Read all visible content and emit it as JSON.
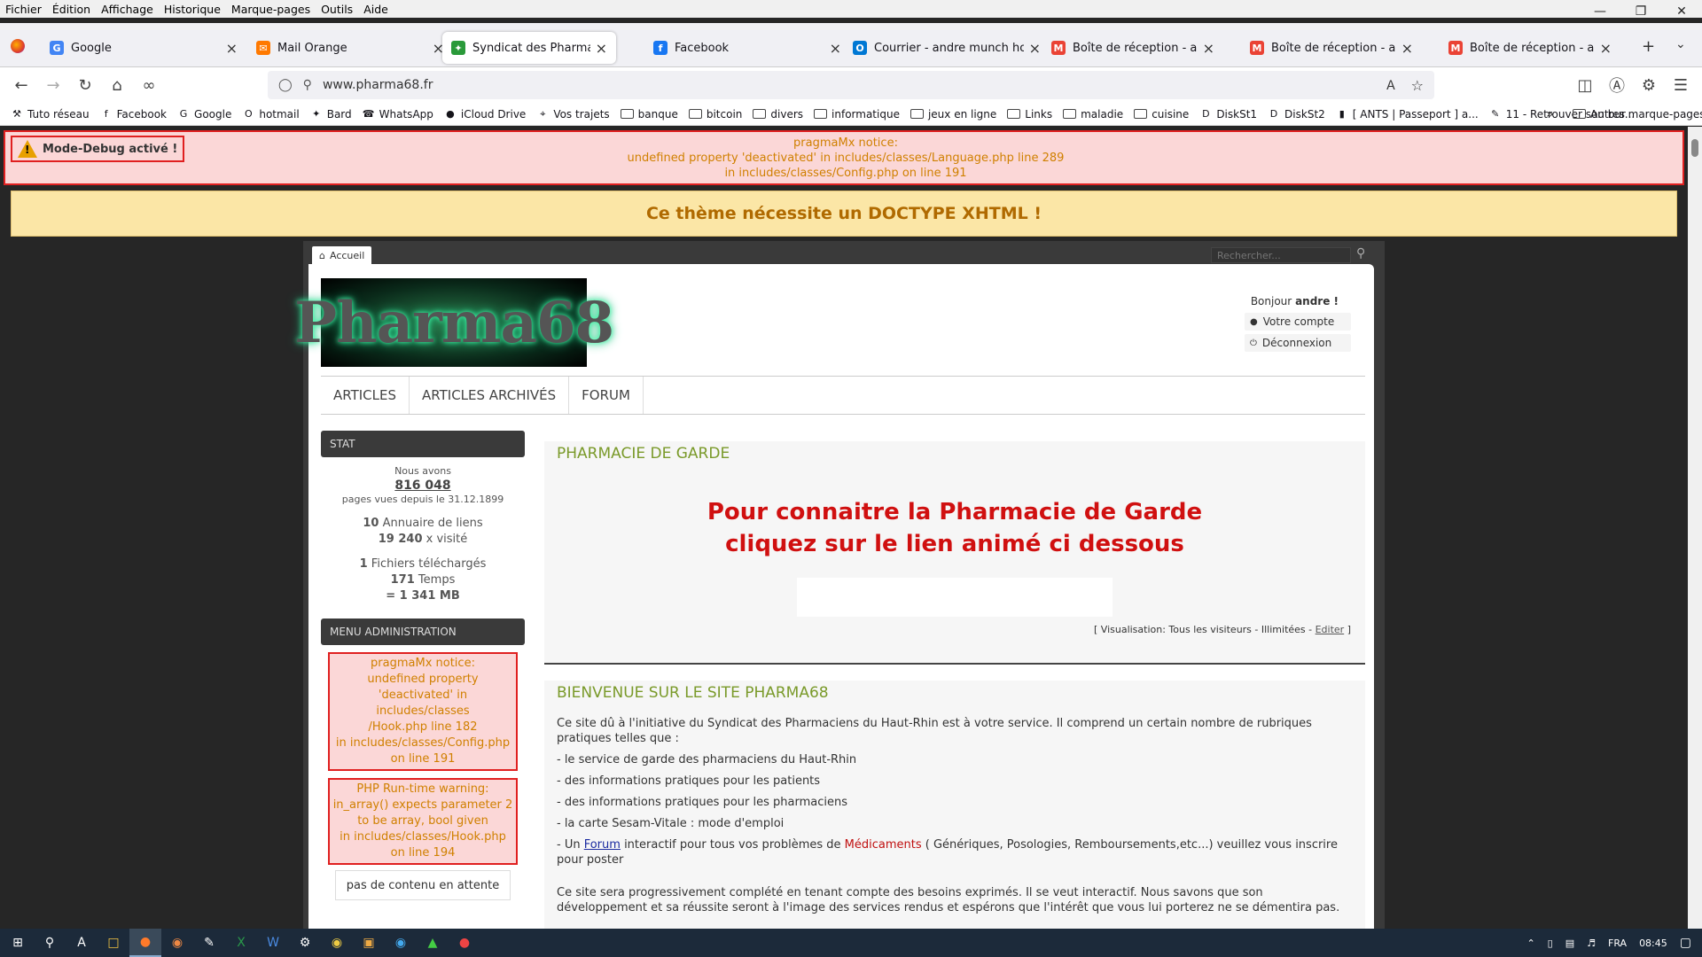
{
  "menubar": {
    "items": [
      "Fichier",
      "Édition",
      "Affichage",
      "Historique",
      "Marque-pages",
      "Outils",
      "Aide"
    ]
  },
  "tabs": [
    {
      "label": "Google",
      "icon": "google-icon",
      "color": "#4285f4",
      "glyph": "G"
    },
    {
      "label": "Mail Orange",
      "icon": "orange-mail-icon",
      "color": "#ff7900",
      "glyph": "✉"
    },
    {
      "label": "Syndicat des Pharmaciens du H",
      "icon": "pharmacy-icon",
      "color": "#2a9a3a",
      "glyph": "✦",
      "active": true
    },
    {
      "label": "Facebook",
      "icon": "facebook-icon",
      "color": "#1877f2",
      "glyph": "f"
    },
    {
      "label": "Courrier - andre munch hotmai",
      "icon": "outlook-icon",
      "color": "#0078d4",
      "glyph": "O"
    },
    {
      "label": "Boîte de réception - andre.mun",
      "icon": "gmail-icon",
      "color": "#ea4335",
      "glyph": "M"
    },
    {
      "label": "Boîte de réception - andremun",
      "icon": "gmail-icon",
      "color": "#ea4335",
      "glyph": "M"
    },
    {
      "label": "Boîte de réception - andremun",
      "icon": "gmail-icon",
      "color": "#ea4335",
      "glyph": "M"
    }
  ],
  "url": "www.pharma68.fr",
  "bookmarks": [
    {
      "label": "Tuto réseau",
      "icon": "hammer-icon",
      "glyph": "⚒"
    },
    {
      "label": "Facebook",
      "icon": "facebook-icon",
      "glyph": "f"
    },
    {
      "label": "Google",
      "icon": "google-icon",
      "glyph": "G"
    },
    {
      "label": "hotmail",
      "icon": "outlook-icon",
      "glyph": "O"
    },
    {
      "label": "Bard",
      "icon": "sparkle-icon",
      "glyph": "✦"
    },
    {
      "label": "WhatsApp",
      "icon": "whatsapp-icon",
      "glyph": "☎"
    },
    {
      "label": "iCloud Drive",
      "icon": "apple-icon",
      "glyph": "●"
    },
    {
      "label": "Vos trajets",
      "icon": "map-pin-icon",
      "glyph": "⌖"
    },
    {
      "label": "banque",
      "folder": true
    },
    {
      "label": "bitcoin",
      "folder": true
    },
    {
      "label": "divers",
      "folder": true
    },
    {
      "label": "informatique",
      "folder": true
    },
    {
      "label": "jeux en ligne",
      "folder": true
    },
    {
      "label": "Links",
      "folder": true
    },
    {
      "label": "maladie",
      "folder": true
    },
    {
      "label": "cuisine",
      "folder": true
    },
    {
      "label": "DiskSt1",
      "icon": "dsm-icon",
      "glyph": "D"
    },
    {
      "label": "DiskSt2",
      "icon": "dsm-icon",
      "glyph": "D"
    },
    {
      "label": "[ ANTS | Passeport ] a...",
      "icon": "flag-icon",
      "glyph": "▮"
    },
    {
      "label": "11 - Retrouver son bur...",
      "icon": "pen-icon",
      "glyph": "✎"
    }
  ],
  "other_bookmarks": "Autres marque-pages",
  "debug": {
    "badge": "Mode-Debug activé !",
    "lines": [
      "pragmaMx notice:",
      "undefined property 'deactivated' in includes/classes/Language.php line 289",
      "in includes/classes/Config.php on line 191"
    ]
  },
  "doctype_warning": "Ce thème nécessite un DOCTYPE XHTML !",
  "site": {
    "home_tab": "Accueil",
    "search_placeholder": "Rechercher...",
    "logo_text": "Pharma68",
    "hello": "Bonjour",
    "user": "andre !",
    "account": "Votre compte",
    "logout": "Déconnexion",
    "nav": [
      "ARTICLES",
      "ARTICLES ARCHIVÉS",
      "FORUM"
    ]
  },
  "stat": {
    "title": "STAT",
    "we_have": "Nous avons",
    "views": "816 048",
    "since": "pages vues depuis le 31.12.1899",
    "links_count": "10",
    "links_label": "Annuaire de liens",
    "links_visits": "19 240",
    "links_visits_label": "x visité",
    "files_count": "1",
    "files_label": "Fichiers téléchargés",
    "times": "171",
    "times_label": "Temps",
    "size": "= 1 341 MB"
  },
  "admin": {
    "title": "MENU ADMINISTRATION",
    "err1": [
      "pragmaMx notice:",
      "undefined property",
      "'deactivated' in includes/classes",
      "/Hook.php line 182",
      "in includes/classes/Config.php",
      "on line 191"
    ],
    "err2": [
      "PHP Run-time warning:",
      "in_array() expects parameter 2",
      "to be array, bool given",
      "in includes/classes/Hook.php",
      "on line 194"
    ],
    "pending": "pas de contenu en attente"
  },
  "garde": {
    "title": "PHARMACIE DE GARDE",
    "line1": "Pour connaitre la Pharmacie de Garde",
    "line2": "cliquez sur le lien animé ci dessous",
    "visu_prefix": "[ Visualisation: Tous les visiteurs - Illimitées - ",
    "visu_edit": "Editer",
    "visu_suffix": " ]"
  },
  "welcome": {
    "title": "BIENVENUE SUR LE SITE PHARMA68",
    "intro": "Ce site dû à l'initiative du Syndicat des Pharmaciens du Haut-Rhin est à votre service. Il comprend un certain nombre de rubriques pratiques telles que :",
    "items": [
      "- le service de garde des pharmaciens du Haut-Rhin",
      "- des informations pratiques pour les patients",
      "- des informations pratiques pour les pharmaciens",
      "- la carte Sesam-Vitale : mode d'emploi"
    ],
    "forum_pre": "- Un ",
    "forum_link": "Forum",
    "forum_mid": " interactif pour tous vos problèmes de ",
    "forum_med": "Médicaments",
    "forum_post": " ( Génériques, Posologies, Remboursements,etc...) veuillez vous inscrire pour poster",
    "outro": "Ce site sera progressivement complété en tenant compte des besoins exprimés. Il se veut interactif. Nous savons que son développement et sa réussite seront à l'image des services rendus et espérons que l'intérêt que vous lui porterez ne se démentira pas."
  },
  "taskbar": {
    "lang": "FRA",
    "time": "08:45"
  }
}
